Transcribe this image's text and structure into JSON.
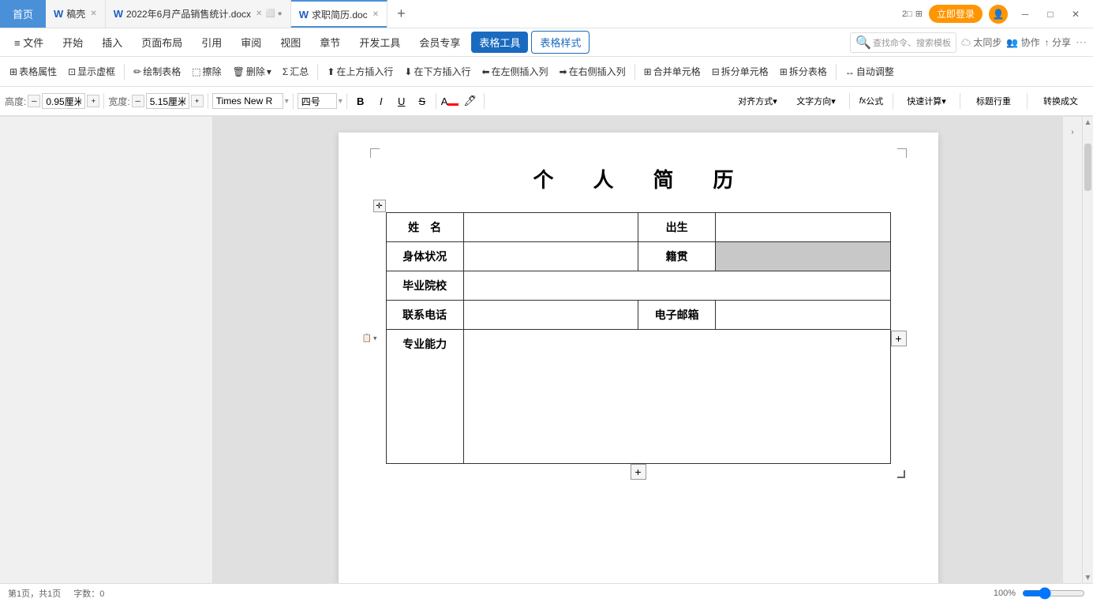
{
  "tabs": [
    {
      "id": "home",
      "label": "首页",
      "active": false,
      "icon": "🏠",
      "closable": false,
      "home": true
    },
    {
      "id": "doc1",
      "label": "稿壳",
      "active": false,
      "icon": "W",
      "closable": true,
      "color": "#c0392b"
    },
    {
      "id": "doc2",
      "label": "2022年6月产品销售统计.docx",
      "active": false,
      "icon": "W",
      "closable": true,
      "color": "#2060c0"
    },
    {
      "id": "doc3",
      "label": "求职简历.doc",
      "active": true,
      "icon": "W",
      "closable": true,
      "color": "#2060c0"
    }
  ],
  "menus": [
    {
      "id": "file",
      "label": "≡ 文件",
      "active": false
    },
    {
      "id": "home",
      "label": "开始",
      "active": false
    },
    {
      "id": "insert",
      "label": "插入",
      "active": false
    },
    {
      "id": "layout",
      "label": "页面布局",
      "active": false
    },
    {
      "id": "ref",
      "label": "引用",
      "active": false
    },
    {
      "id": "review",
      "label": "审阅",
      "active": false
    },
    {
      "id": "view",
      "label": "视图",
      "active": false
    },
    {
      "id": "chapter",
      "label": "章节",
      "active": false
    },
    {
      "id": "dev",
      "label": "开发工具",
      "active": false
    },
    {
      "id": "vip",
      "label": "会员专享",
      "active": false
    },
    {
      "id": "table_tool",
      "label": "表格工具",
      "active": true,
      "highlighted": true
    },
    {
      "id": "table_style",
      "label": "表格样式",
      "active": false,
      "highlighted_outline": true
    }
  ],
  "toolbar1": {
    "search_placeholder": "查找命令、搜索模板",
    "sync_label": "太同步",
    "collab_label": "协作",
    "share_label": "分享",
    "items": [
      {
        "id": "table_prop",
        "label": "表格属性"
      },
      {
        "id": "show_border",
        "label": "显示虚框"
      },
      {
        "id": "draw_table",
        "label": "绘制表格"
      },
      {
        "id": "erase",
        "label": "擦除"
      },
      {
        "id": "delete",
        "label": "删除"
      },
      {
        "id": "summary",
        "label": "汇总"
      },
      {
        "id": "insert_above",
        "label": "在上方插入行"
      },
      {
        "id": "insert_below",
        "label": "在下方插入行"
      },
      {
        "id": "insert_left",
        "label": "在左侧插入列"
      },
      {
        "id": "insert_right",
        "label": "在右侧插入列"
      },
      {
        "id": "merge_cell",
        "label": "合并单元格"
      },
      {
        "id": "split_cell",
        "label": "拆分单元格"
      },
      {
        "id": "split_table",
        "label": "拆分表格"
      },
      {
        "id": "auto_fit",
        "label": "自动调整"
      },
      {
        "id": "quick_calc",
        "label": "快速计算"
      },
      {
        "id": "title_row",
        "label": "标题行重"
      }
    ]
  },
  "toolbar2": {
    "height_label": "高度:",
    "height_value": "0.95厘米",
    "width_label": "宽度:",
    "width_value": "5.15厘米",
    "font_name": "Times New R",
    "font_size": "四号",
    "align_label": "对齐方式",
    "text_dir_label": "文字方向",
    "formula_label": "公式",
    "convert_label": "转换成文"
  },
  "document": {
    "title": "个　人　简　历",
    "table": {
      "rows": [
        [
          {
            "label": "姓　名",
            "type": "label"
          },
          {
            "label": "",
            "type": "value"
          },
          {
            "label": "出生",
            "type": "label"
          },
          {
            "label": "",
            "type": "value"
          }
        ],
        [
          {
            "label": "身体状况",
            "type": "label"
          },
          {
            "label": "",
            "type": "value"
          },
          {
            "label": "籍贯",
            "type": "label"
          },
          {
            "label": "",
            "type": "value",
            "gray": true
          }
        ],
        [
          {
            "label": "毕业院校",
            "type": "label"
          },
          {
            "label": "",
            "type": "value",
            "colspan": 3
          }
        ],
        [
          {
            "label": "联系电话",
            "type": "label"
          },
          {
            "label": "",
            "type": "value"
          },
          {
            "label": "电子邮箱",
            "type": "label"
          },
          {
            "label": "",
            "type": "value"
          }
        ],
        [
          {
            "label": "专业能力",
            "type": "label",
            "tall": true
          },
          {
            "label": "",
            "type": "value",
            "colspan": 3,
            "tall": true
          }
        ]
      ]
    }
  },
  "bottom": {
    "page_info": "第1页，共1页",
    "word_count": "字数：0",
    "zoom": "100%"
  }
}
